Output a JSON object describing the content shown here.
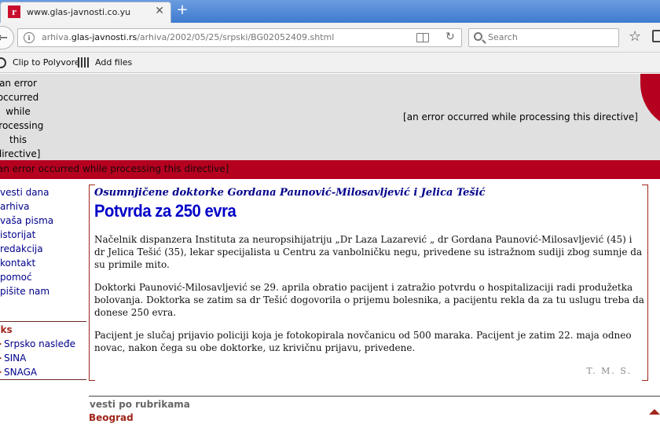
{
  "browser": {
    "tab_title": "www.glas-javnosti.co.yu",
    "tab_favicon_letter": "r",
    "url_prefix": "arhiva.",
    "url_domain": "glas-javnosti.rs",
    "url_path": "/arhiva/2002/05/25/srpski/BG02052409.shtml",
    "search_placeholder": "Search",
    "bookmarks": [
      "Clip to Polyvore",
      "Add files"
    ]
  },
  "header": {
    "left_error": "an error occurred while processing this directive]",
    "right_error": "[an error occurred while processing this directive]",
    "bar_error": "an error occurred while processing this directive]",
    "accent_color": "#b5001f"
  },
  "nav": {
    "items": [
      "vesti dana",
      "arhiva",
      "vaša pisma",
      "istorijat",
      "redakcija",
      "kontakt",
      "pomoć",
      "pišite nam"
    ],
    "links_heading": "nks",
    "links": [
      "Srpsko nasleđe",
      "SINA",
      "SNAGA"
    ]
  },
  "article": {
    "kicker": "Osumnjičene doktorke Gordana Paunović-Milosavljević i Jelica Tešić",
    "headline": "Potvrda za 250 evra",
    "paragraphs": [
      "Načelnik dispanzera Instituta za neuropsihijatriju „Dr Laza Lazarević „ dr Gordana Paunović-Milosavljević (45) i dr Jelica Tešić (35), lekar specijalista u Centru za vanbolničku negu, privedene su istražnom sudiji zbog sumnje da su primile mito.",
      "Doktorki Paunović-Milosavljević se 29. aprila obratio pacijent i zatražio potvrdu o hospitalizaciji radi produžetka bolovanja. Doktorka se zatim sa dr Tešić dogovorila o prijemu bolesnika, a pacijentu rekla da za tu uslugu treba da donese 250 evra.",
      "Pacijent je slučaj prijavio policiji koja je fotokopirala novčanicu od 500 maraka. Pacijent je zatim 22. maja odneo novac, nakon čega su obe doktorke, uz krivičnu prijavu, privedene."
    ],
    "signature": "T. M. S."
  },
  "footer": {
    "rubrics_label": "vesti po rubrikama",
    "city": "Beograd"
  }
}
